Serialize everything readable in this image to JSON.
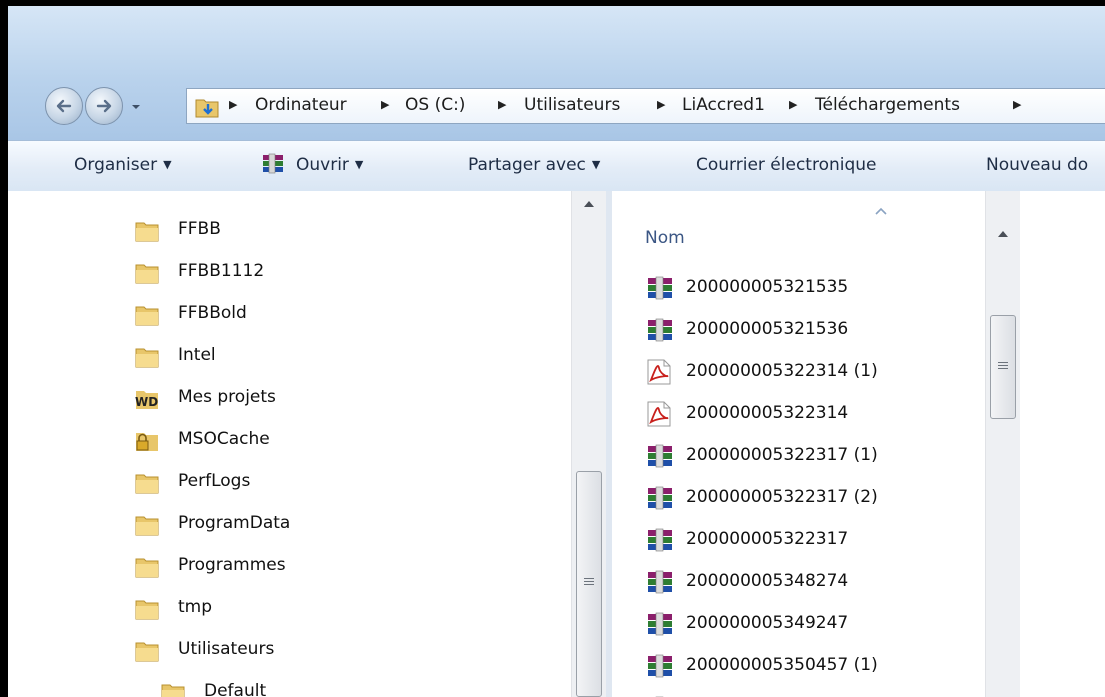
{
  "address": {
    "crumbs": [
      "Ordinateur",
      "OS (C:)",
      "Utilisateurs",
      "LiAccred1",
      "Téléchargements"
    ]
  },
  "toolbar": {
    "organise_label": "Organiser",
    "open_label": "Ouvrir",
    "share_label": "Partager avec",
    "email_label": "Courrier électronique",
    "new_folder_label": "Nouveau do"
  },
  "nav_tree": {
    "items": [
      {
        "label": "FFBB",
        "icon": "folder-icon"
      },
      {
        "label": "FFBB1112",
        "icon": "folder-icon"
      },
      {
        "label": "FFBBold",
        "icon": "folder-icon"
      },
      {
        "label": "Intel",
        "icon": "folder-icon"
      },
      {
        "label": "Mes projets",
        "icon": "windev-project-icon"
      },
      {
        "label": "MSOCache",
        "icon": "locked-folder-icon"
      },
      {
        "label": "PerfLogs",
        "icon": "folder-icon"
      },
      {
        "label": "ProgramData",
        "icon": "folder-icon"
      },
      {
        "label": "Programmes",
        "icon": "folder-icon"
      },
      {
        "label": "tmp",
        "icon": "folder-icon"
      },
      {
        "label": "Utilisateurs",
        "icon": "folder-icon"
      },
      {
        "label": "Default",
        "icon": "folder-icon"
      }
    ]
  },
  "file_list": {
    "column_name": "Nom",
    "files": [
      {
        "name": "200000005321535",
        "icon": "winrar-archive-icon"
      },
      {
        "name": "200000005321536",
        "icon": "winrar-archive-icon"
      },
      {
        "name": "200000005322314 (1)",
        "icon": "pdf-icon"
      },
      {
        "name": "200000005322314",
        "icon": "pdf-icon"
      },
      {
        "name": "200000005322317 (1)",
        "icon": "winrar-archive-icon"
      },
      {
        "name": "200000005322317 (2)",
        "icon": "winrar-archive-icon"
      },
      {
        "name": "200000005322317",
        "icon": "winrar-archive-icon"
      },
      {
        "name": "200000005348274",
        "icon": "winrar-archive-icon"
      },
      {
        "name": "200000005349247",
        "icon": "winrar-archive-icon"
      },
      {
        "name": "200000005350457 (1)",
        "icon": "winrar-archive-icon"
      },
      {
        "name": "",
        "icon": "winrar-archive-icon"
      }
    ]
  },
  "colors": {
    "folder": "#e8c66a",
    "pdf": "#c8201c",
    "header_text": "#3b5684"
  }
}
